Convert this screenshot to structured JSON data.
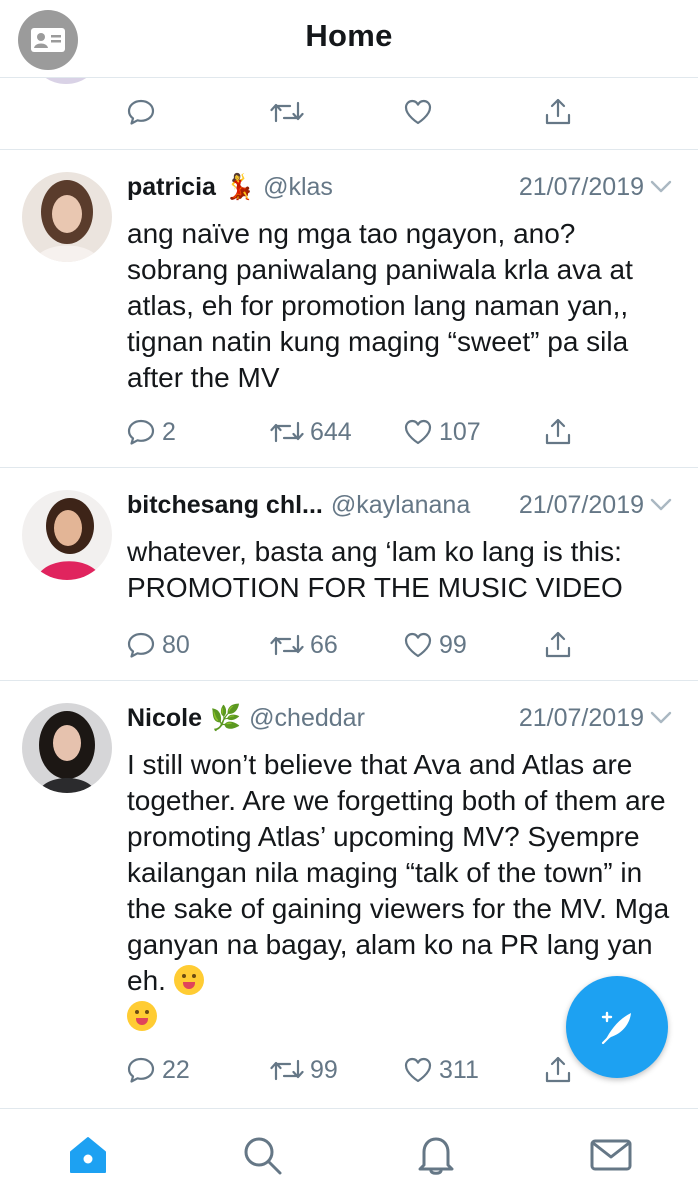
{
  "header": {
    "title": "Home",
    "profile_icon": "contact-card-icon"
  },
  "prev_tweet": {
    "actions": {
      "reply_icon": "reply-icon",
      "retweet_icon": "retweet-icon",
      "like_icon": "heart-icon",
      "share_icon": "share-icon"
    }
  },
  "tweets": [
    {
      "name": "patricia",
      "emoji": "💃",
      "handle": "@klas",
      "date": "21/07/2019",
      "text": "ang naïve ng mga tao ngayon, ano? sobrang paniwalang paniwala krla ava at atlas, eh for promotion lang naman yan,, tignan natin kung maging “sweet” pa sila after the MV",
      "replies": "2",
      "retweets": "644",
      "likes": "107"
    },
    {
      "name": "bitchesang chl...",
      "emoji": "",
      "handle": "@kaylanana",
      "date": "21/07/2019",
      "text": "whatever, basta ang ‘lam ko lang is this: PROMOTION FOR THE MUSIC VIDEO",
      "replies": "80",
      "retweets": "66",
      "likes": "99"
    },
    {
      "name": "Nicole",
      "emoji": "🌿",
      "handle": "@cheddar",
      "date": "21/07/2019",
      "text": "I still won’t believe that Ava and Atlas are together. Are we forgetting both of them are promoting Atlas’ upcoming MV? Syempre kailangan nila maging “talk of the town” in the sake of gaining viewers for the MV. Mga ganyan na bagay, alam ko na PR lang yan eh.",
      "replies": "22",
      "retweets": "99",
      "likes": "311"
    }
  ],
  "tabs": [
    {
      "name": "home-tab",
      "icon": "home-icon",
      "color": "#1da1f2"
    },
    {
      "name": "search-tab",
      "icon": "search-icon",
      "color": "#657786"
    },
    {
      "name": "notifications-tab",
      "icon": "bell-icon",
      "color": "#657786"
    },
    {
      "name": "messages-tab",
      "icon": "mail-icon",
      "color": "#657786"
    }
  ],
  "compose": {
    "icon": "compose-feather-icon",
    "color": "#1da1f2"
  }
}
